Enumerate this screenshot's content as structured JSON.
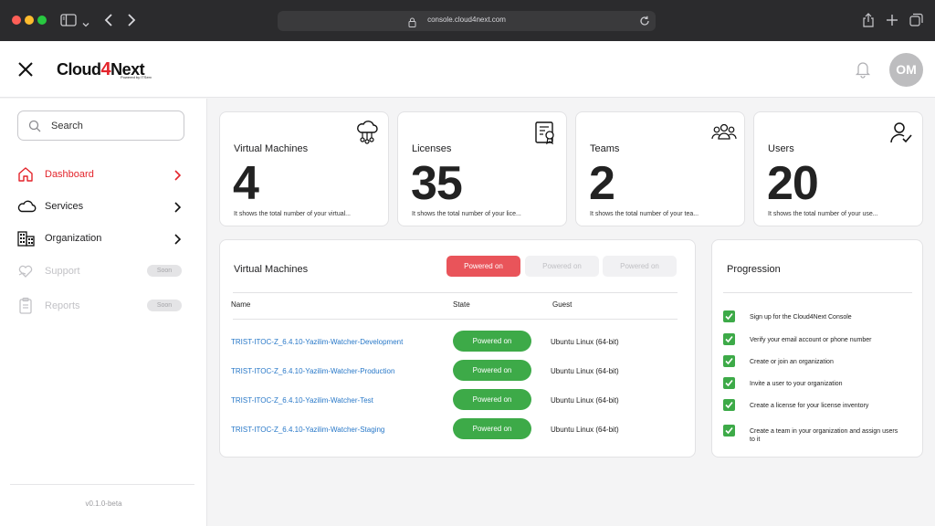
{
  "browser": {
    "url": "console.cloud4next.com",
    "icons": [
      "sidebar-icon",
      "chevron-down-icon",
      "back-icon",
      "forward-icon",
      "lock-icon",
      "reload-icon",
      "share-icon",
      "new-tab-icon",
      "tabs-icon"
    ]
  },
  "header": {
    "logo_prefix": "Cloud",
    "logo_mark": "4",
    "logo_suffix": "Next",
    "logo_powered": "Powered by ITServ",
    "avatar_initials": "OM"
  },
  "sidebar": {
    "search_label": "Search",
    "items": [
      {
        "label": "Dashboard",
        "icon": "home-icon",
        "active": true
      },
      {
        "label": "Services",
        "icon": "cloud-icon"
      },
      {
        "label": "Organization",
        "icon": "buildings-icon"
      },
      {
        "label": "Support",
        "icon": "heart-hand-icon",
        "badge": "Soon"
      },
      {
        "label": "Reports",
        "icon": "clipboard-icon",
        "badge": "Soon"
      }
    ],
    "version": "v0.1.0-beta"
  },
  "stats": [
    {
      "title": "Virtual Machines",
      "value": "4",
      "description": "It shows the total number of your virtual...",
      "icon": "cloud-network-icon"
    },
    {
      "title": "Licenses",
      "value": "35",
      "description": "It shows the total number of your lice...",
      "icon": "certificate-icon"
    },
    {
      "title": "Teams",
      "value": "2",
      "description": "It shows the total number of your tea...",
      "icon": "team-icon"
    },
    {
      "title": "Users",
      "value": "20",
      "description": "It shows the total number of your use...",
      "icon": "user-check-icon"
    }
  ],
  "vm_panel": {
    "title": "Virtual Machines",
    "filters": [
      "Powered on",
      "Powered on",
      "Powered on"
    ],
    "columns": [
      "Name",
      "State",
      "Guest"
    ],
    "rows": [
      {
        "name": "TRIST-ITOC-Z_6.4.10-Yazilim-Watcher-Development",
        "state": "Powered on",
        "guest": "Ubuntu Linux (64-bit)"
      },
      {
        "name": "TRIST-ITOC-Z_6.4.10-Yazilim-Watcher-Production",
        "state": "Powered on",
        "guest": "Ubuntu Linux (64-bit)"
      },
      {
        "name": "TRIST-ITOC-Z_6.4.10-Yazilim-Watcher-Test",
        "state": "Powered on",
        "guest": "Ubuntu Linux (64-bit)"
      },
      {
        "name": "TRIST-ITOC-Z_6.4.10-Yazilim-Watcher-Staging",
        "state": "Powered on",
        "guest": "Ubuntu Linux (64-bit)"
      }
    ],
    "state_color": "#3daa48",
    "filter_active_color": "#e9545a"
  },
  "progression": {
    "title": "Progression",
    "steps": [
      "Sign up for the Cloud4Next Console",
      "Verify your email account or phone number",
      "Create or join an organization",
      "Invite a user to your organization",
      "Create a license for your license inventory",
      "Create a team in your organization and assign users to it"
    ]
  },
  "colors": {
    "brand_red": "#e3242b",
    "link_blue": "#2878c8",
    "success_green": "#3daa48"
  }
}
